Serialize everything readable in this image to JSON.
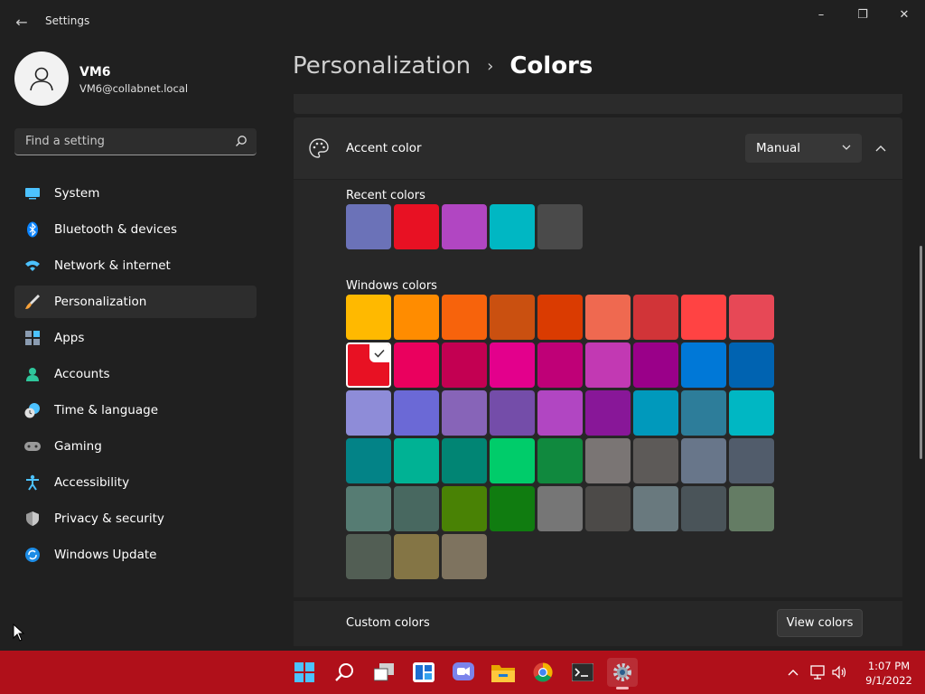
{
  "window": {
    "title": "Settings",
    "back_glyph": "←",
    "minimize": "–",
    "maximize": "❐",
    "close": "✕"
  },
  "profile": {
    "name": "VM6",
    "email": "VM6@collabnet.local"
  },
  "search": {
    "placeholder": "Find a setting"
  },
  "nav": [
    {
      "label": "System",
      "icon": "system-icon",
      "selected": false
    },
    {
      "label": "Bluetooth & devices",
      "icon": "bluetooth-icon",
      "selected": false
    },
    {
      "label": "Network & internet",
      "icon": "wifi-icon",
      "selected": false
    },
    {
      "label": "Personalization",
      "icon": "paintbrush-icon",
      "selected": true
    },
    {
      "label": "Apps",
      "icon": "apps-icon",
      "selected": false
    },
    {
      "label": "Accounts",
      "icon": "accounts-icon",
      "selected": false
    },
    {
      "label": "Time & language",
      "icon": "clock-globe-icon",
      "selected": false
    },
    {
      "label": "Gaming",
      "icon": "gamepad-icon",
      "selected": false
    },
    {
      "label": "Accessibility",
      "icon": "accessibility-icon",
      "selected": false
    },
    {
      "label": "Privacy & security",
      "icon": "shield-icon",
      "selected": false
    },
    {
      "label": "Windows Update",
      "icon": "update-icon",
      "selected": false
    }
  ],
  "header": {
    "parent": "Personalization",
    "separator": "›",
    "current": "Colors"
  },
  "accent": {
    "title": "Accent color",
    "mode": "Manual",
    "recent_label": "Recent colors",
    "recent_colors": [
      "#6b72b8",
      "#e81123",
      "#b146c2",
      "#00b7c3",
      "#4a4a4a"
    ],
    "windows_label": "Windows colors",
    "windows_colors": [
      [
        "#ffb900",
        "#ff8c00",
        "#f7630c",
        "#ca5010",
        "#da3b01",
        "#ef6950",
        "#d13438",
        "#ff4343",
        "#e74856"
      ],
      [
        "#e81123",
        "#ea005e",
        "#c30052",
        "#e3008c",
        "#bf0077",
        "#c239b3",
        "#9a0089",
        "#0078d7",
        "#0063b1"
      ],
      [
        "#8e8cd8",
        "#6b69d6",
        "#8764b8",
        "#744da9",
        "#b146c2",
        "#881798",
        "#0099bc",
        "#2d7d9a",
        "#00b7c3"
      ],
      [
        "#038387",
        "#00b294",
        "#018574",
        "#00cc6a",
        "#10893e",
        "#7a7574",
        "#5d5a58",
        "#68768a",
        "#515c6b"
      ],
      [
        "#567c73",
        "#486860",
        "#498205",
        "#107c10",
        "#767676",
        "#4c4a48",
        "#69797e",
        "#4a5459",
        "#647c64"
      ],
      [
        "#525e54",
        "#847545",
        "#7e735f"
      ]
    ],
    "selected_color": "#e81123"
  },
  "custom": {
    "label": "Custom colors",
    "button": "View colors"
  },
  "taskbar": {
    "apps": [
      "start-icon",
      "search-icon",
      "task-view-icon",
      "widgets-icon",
      "chat-icon",
      "file-explorer-icon",
      "chrome-icon",
      "terminal-icon",
      "settings-icon"
    ],
    "time": "1:07 PM",
    "date": "9/1/2022"
  },
  "colors": {
    "taskbar": "#b0101a",
    "accent": "#e81123",
    "background": "#202020"
  }
}
